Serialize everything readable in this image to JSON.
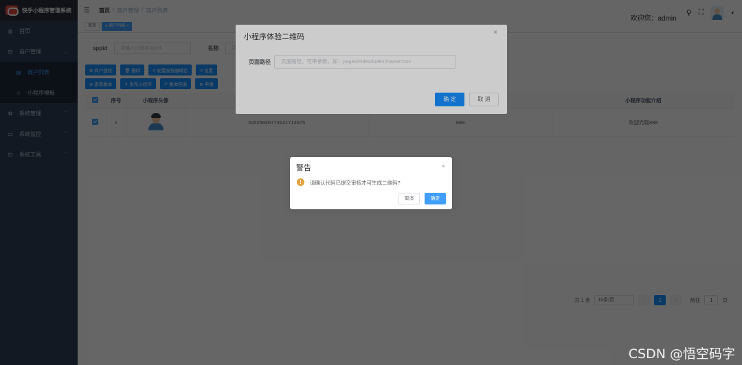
{
  "app": {
    "title": "快手小程序管理系统"
  },
  "sidebar": {
    "items": [
      {
        "label": "首页",
        "icon": "dashboard-icon"
      },
      {
        "label": "商户管理",
        "icon": "shop-icon"
      },
      {
        "label": "商户列表",
        "icon": "list-icon"
      },
      {
        "label": "小程序模板",
        "icon": "star-icon"
      },
      {
        "label": "系统管理",
        "icon": "gear-icon"
      },
      {
        "label": "系统监控",
        "icon": "monitor-icon"
      },
      {
        "label": "系统工具",
        "icon": "tool-icon"
      }
    ]
  },
  "header": {
    "breadcrumb": [
      "首页",
      "商户管理",
      "商户列表"
    ],
    "welcome": "欢迎您：admin"
  },
  "tags": {
    "home": "首页",
    "current": "● 商户列表 ×"
  },
  "search": {
    "appid_label": "appid",
    "appid_placeholder": "请输入小程序appid",
    "name_label": "名称",
    "name_placeholder": "请输"
  },
  "toolbar": {
    "row1": [
      "⊕ 商户授权",
      "🗑 删除",
      "≡ 设置服务器域名",
      "≡ 设置"
    ],
    "row2": [
      "⊕ 查看版本",
      "✈ 发布小程序",
      "↶ 版本回退",
      "⊕ 申请"
    ]
  },
  "table": {
    "headers": [
      "",
      "序号",
      "小程序头像",
      "",
      "",
      "小程序功能介绍"
    ],
    "rows": [
      {
        "index": "1",
        "appid": "ks525846773141714975",
        "name": "888",
        "intro": "欢迎光临888"
      }
    ]
  },
  "pagination": {
    "total": "共 1 条",
    "page_size": "10条/页",
    "current": "1",
    "goto_label": "前往",
    "goto_value": "1",
    "page_unit": "页"
  },
  "dialog": {
    "title": "小程序体验二维码",
    "path_label": "页面路径",
    "path_placeholder": "页面路径，可带参数，如：pages/index/index?name=xxx",
    "confirm": "确 定",
    "cancel": "取 消"
  },
  "messagebox": {
    "title": "警告",
    "text": "请确认代码已提交审核才可生成二维码?",
    "cancel": "取消",
    "confirm": "确定"
  },
  "watermark": "CSDN @悟空码字",
  "colors": {
    "primary": "#1890ff",
    "sidebar": "#304156",
    "warning": "#e6a23c"
  }
}
